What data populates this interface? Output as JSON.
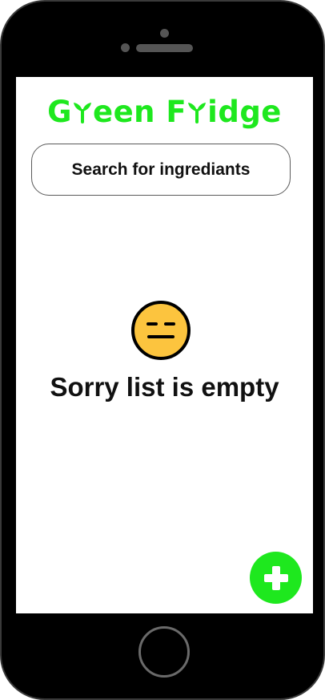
{
  "app": {
    "brand_part1": "G",
    "brand_part2": "een F",
    "brand_part3": "idge",
    "brand_color": "#1ee81e",
    "brand_icon": "sprout-icon"
  },
  "search": {
    "label": "Search for ingrediants"
  },
  "empty_state": {
    "icon": "neutral-face-icon",
    "message": "Sorry list is empty"
  },
  "fab": {
    "icon": "plus-icon",
    "color": "#1ee81e"
  },
  "device": {
    "frame_color": "#000000"
  }
}
